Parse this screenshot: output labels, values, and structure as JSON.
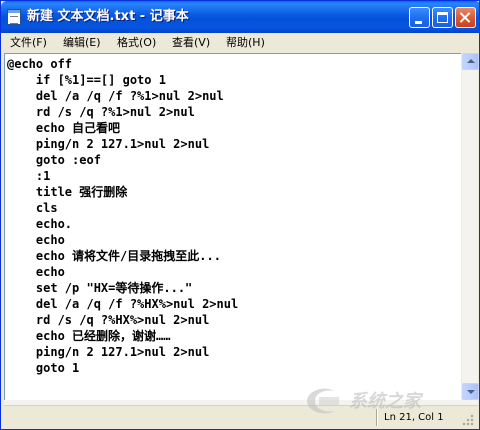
{
  "window": {
    "title": "新建 文本文档.txt - 记事本",
    "icon": "notepad-icon"
  },
  "menu": [
    {
      "label": "文件(F)"
    },
    {
      "label": "编辑(E)"
    },
    {
      "label": "格式(O)"
    },
    {
      "label": "查看(V)"
    },
    {
      "label": "帮助(H)"
    }
  ],
  "editor": {
    "lines": [
      "@echo off",
      "    if [%1]==[] goto 1",
      "    del /a /q /f ?%1>nul 2>nul",
      "    rd /s /q ?%1>nul 2>nul",
      "    echo 自己看吧",
      "    ping/n 2 127.1>nul 2>nul",
      "    goto :eof",
      "    :1",
      "    title 强行删除",
      "    cls",
      "    echo.",
      "    echo",
      "    echo 请将文件/目录拖拽至此...",
      "    echo",
      "    set /p \"HX=等待操作...\"",
      "    del /a /q /f ?%HX%>nul 2>nul",
      "    rd /s /q ?%HX%>nul 2>nul",
      "    echo 已经删除，谢谢……",
      "    ping/n 2 127.1>nul 2>nul",
      "    goto 1"
    ]
  },
  "status": {
    "position": "Ln 21, Col 1"
  },
  "watermark": {
    "text": "系统之家"
  },
  "colors": {
    "titlebar": "#0758e2",
    "window_frame": "#ece9d8",
    "close_button": "#dc5a35"
  }
}
